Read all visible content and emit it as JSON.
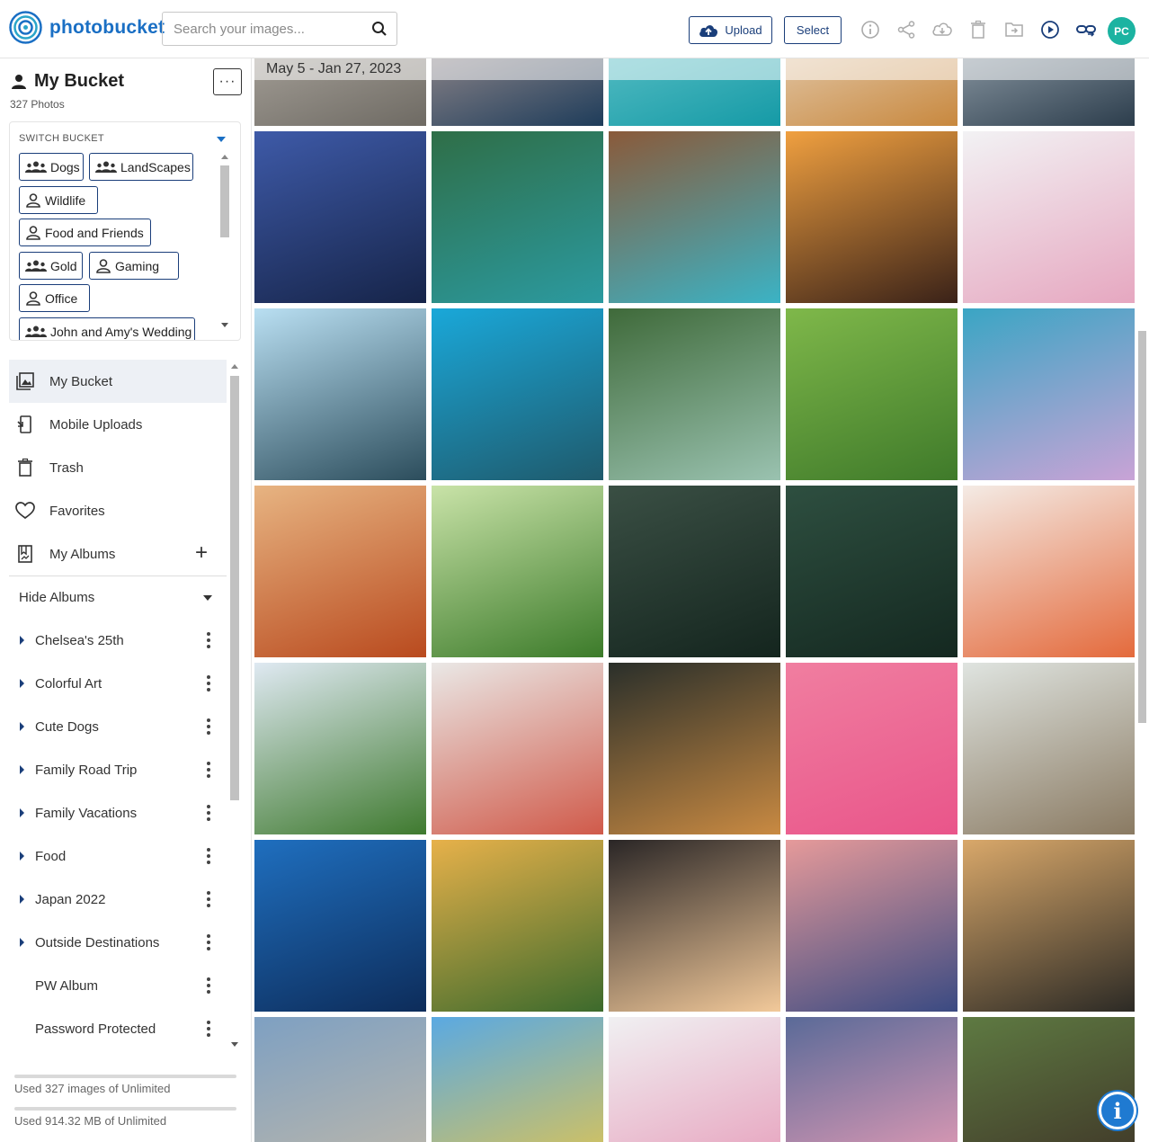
{
  "header": {
    "brand": "photobucket",
    "search_placeholder": "Search your images...",
    "upload_label": "Upload",
    "select_label": "Select",
    "avatar_initials": "PC",
    "accent": "#1a3e7a",
    "avatar_color": "#1bb3a1"
  },
  "bucket": {
    "title": "My Bucket",
    "count": "327 Photos",
    "more": "···",
    "switch_label": "SWITCH BUCKET",
    "chips": [
      {
        "label": "Dogs",
        "icon": "group-icon"
      },
      {
        "label": "LandScapes",
        "icon": "group-icon"
      },
      {
        "label": "Wildlife",
        "icon": "person-icon"
      },
      {
        "label": "Food and Friends",
        "icon": "person-icon"
      },
      {
        "label": "Gold",
        "icon": "group-icon"
      },
      {
        "label": "Gaming",
        "icon": "person-icon"
      },
      {
        "label": "Office",
        "icon": "person-icon"
      },
      {
        "label": "John and Amy's Wedding",
        "icon": "group-icon"
      }
    ]
  },
  "nav": {
    "items": [
      {
        "label": "My Bucket",
        "icon": "gallery-icon",
        "active": true
      },
      {
        "label": "Mobile Uploads",
        "icon": "mobile-upload-icon"
      },
      {
        "label": "Trash",
        "icon": "trash-icon"
      },
      {
        "label": "Favorites",
        "icon": "heart-icon"
      },
      {
        "label": "My Albums",
        "icon": "album-icon"
      }
    ],
    "add_album": "+",
    "hide_albums": "Hide Albums",
    "albums": [
      {
        "label": "Chelsea's 25th",
        "expandable": true
      },
      {
        "label": "Colorful Art",
        "expandable": true
      },
      {
        "label": "Cute Dogs",
        "expandable": true
      },
      {
        "label": "Family Road Trip",
        "expandable": true
      },
      {
        "label": "Family Vacations",
        "expandable": true
      },
      {
        "label": "Food",
        "expandable": true
      },
      {
        "label": "Japan 2022",
        "expandable": true
      },
      {
        "label": "Outside Destinations",
        "expandable": true
      },
      {
        "label": "PW Album",
        "expandable": false
      },
      {
        "label": "Password Protected",
        "expandable": false
      }
    ]
  },
  "usage": {
    "images": "Used 327 images of Unlimited",
    "storage": "Used 914.32 MB of Unlimited"
  },
  "gallery": {
    "date_range": "May 5 - Jan 27, 2023",
    "photos": [
      {
        "c1": "#c9c3bb",
        "c2": "#6e6a63"
      },
      {
        "c1": "#d8b6a8",
        "c2": "#1e3c5a"
      },
      {
        "c1": "#7fd3d6",
        "c2": "#159aa6"
      },
      {
        "c1": "#f1eee9",
        "c2": "#c8883e"
      },
      {
        "c1": "#c7d2da",
        "c2": "#2c3d4c"
      },
      {
        "c1": "#3e5aa8",
        "c2": "#162449"
      },
      {
        "c1": "#2f6e47",
        "c2": "#2b9aa0"
      },
      {
        "c1": "#8a5a3a",
        "c2": "#3bb3c5"
      },
      {
        "c1": "#f0a040",
        "c2": "#3a2218"
      },
      {
        "c1": "#f2f2f4",
        "c2": "#e6a7c0"
      },
      {
        "c1": "#b9dff2",
        "c2": "#2c4d5c"
      },
      {
        "c1": "#1aa8d9",
        "c2": "#1f5a6c"
      },
      {
        "c1": "#3f6a3a",
        "c2": "#9ac2b0"
      },
      {
        "c1": "#7fb84a",
        "c2": "#3f7a2a"
      },
      {
        "c1": "#3aa5c4",
        "c2": "#c9a3d6"
      },
      {
        "c1": "#e7b482",
        "c2": "#b94a1e"
      },
      {
        "c1": "#c9e3a8",
        "c2": "#3c7b2a"
      },
      {
        "c1": "#3a4f44",
        "c2": "#14251e"
      },
      {
        "c1": "#2e4f40",
        "c2": "#142820"
      },
      {
        "c1": "#f4ebe5",
        "c2": "#e46a3c"
      },
      {
        "c1": "#dfe9f2",
        "c2": "#3f7a2f"
      },
      {
        "c1": "#eae8e6",
        "c2": "#d05a4a"
      },
      {
        "c1": "#2a2f2a",
        "c2": "#c98a42"
      },
      {
        "c1": "#f07ea0",
        "c2": "#e9558a"
      },
      {
        "c1": "#dfe4e0",
        "c2": "#8a7a62"
      },
      {
        "c1": "#1f6fbf",
        "c2": "#0d2c5a"
      },
      {
        "c1": "#e7b14a",
        "c2": "#3c6a2c"
      },
      {
        "c1": "#2a2626",
        "c2": "#f2c99a"
      },
      {
        "c1": "#e69a9a",
        "c2": "#3a4a82"
      },
      {
        "c1": "#d9a86a",
        "c2": "#2c2a25"
      },
      {
        "c1": "#7ea0c2",
        "c2": "#c2b9a8"
      },
      {
        "c1": "#5aa9e2",
        "c2": "#e7c64a"
      },
      {
        "c1": "#f0f0f2",
        "c2": "#e69ab8"
      },
      {
        "c1": "#5a6a98",
        "c2": "#f0a0b8"
      },
      {
        "c1": "#5e7a42",
        "c2": "#3c2f25"
      }
    ]
  }
}
